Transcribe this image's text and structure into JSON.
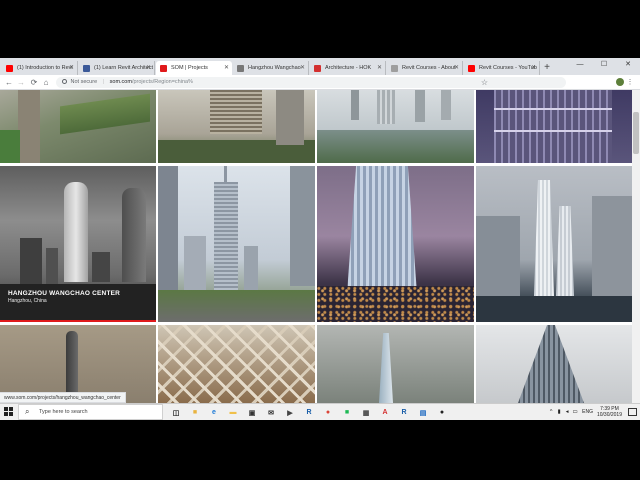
{
  "browser": {
    "tabs": [
      {
        "label": "(1) Introduction to Revi",
        "favicon": "youtube-icon",
        "color": "#ff0000",
        "active": false
      },
      {
        "label": "(1) Learn Revit Architect",
        "favicon": "facebook-icon",
        "color": "#3b5998",
        "active": false
      },
      {
        "label": "SOM | Projects",
        "favicon": "som-icon",
        "color": "#e0191b",
        "active": true
      },
      {
        "label": "Hangzhou Wangchao",
        "favicon": "page-icon",
        "color": "#777777",
        "active": false
      },
      {
        "label": "Architecture - HOK",
        "favicon": "hok-icon",
        "color": "#d32f2f",
        "active": false
      },
      {
        "label": "Revit Courses - About",
        "favicon": "page-icon",
        "color": "#9e9e9e",
        "active": false
      },
      {
        "label": "Revit Courses - YouTub",
        "favicon": "youtube-icon",
        "color": "#ff0000",
        "active": false
      }
    ],
    "new_tab": "+",
    "window_controls": [
      "—",
      "☐",
      "✕"
    ],
    "nav": {
      "back": "←",
      "forward": "→",
      "reload": "⟳",
      "home": "⌂"
    },
    "address": {
      "security": "Not secure",
      "separator": "|",
      "host": "som.com",
      "path": "/projects/Region=china%"
    },
    "bookmark_star": "☆",
    "menu": "⋮"
  },
  "page": {
    "featured": {
      "title": "HANGZHOU WANGCHAO CENTER",
      "subtitle": "Hangzhou, China"
    },
    "status_url": "www.som.com/projects/hangzhou_wangchao_center"
  },
  "taskbar": {
    "search_placeholder": "Type here to search",
    "apps": [
      {
        "name": "task-view-icon",
        "glyph": "◫",
        "color": "#222222"
      },
      {
        "name": "file-explorer-icon",
        "glyph": "■",
        "color": "#e8b33f"
      },
      {
        "name": "edge-icon",
        "glyph": "e",
        "color": "#1e7ad6"
      },
      {
        "name": "folder-icon",
        "glyph": "▬",
        "color": "#f0c04a"
      },
      {
        "name": "store-icon",
        "glyph": "▣",
        "color": "#333333"
      },
      {
        "name": "mail-icon",
        "glyph": "✉",
        "color": "#333333"
      },
      {
        "name": "media-icon",
        "glyph": "▶",
        "color": "#444444"
      },
      {
        "name": "revit-icon",
        "glyph": "R",
        "color": "#1a5ea8"
      },
      {
        "name": "chrome-icon",
        "glyph": "●",
        "color": "#db4437"
      },
      {
        "name": "app-green-icon",
        "glyph": "■",
        "color": "#1db954"
      },
      {
        "name": "calculator-icon",
        "glyph": "▦",
        "color": "#444444"
      },
      {
        "name": "acrobat-icon",
        "glyph": "A",
        "color": "#d32f2f"
      },
      {
        "name": "revit2-icon",
        "glyph": "R",
        "color": "#1a5ea8"
      },
      {
        "name": "photos-icon",
        "glyph": "▤",
        "color": "#1565c0"
      },
      {
        "name": "app-dark-icon",
        "glyph": "●",
        "color": "#222222"
      }
    ],
    "tray": {
      "language": "ENG",
      "time": "7:39 PM",
      "date": "10/30/2019"
    }
  },
  "colors": {
    "accent": "#e0191b",
    "caption_bg": "#2a2a2a"
  }
}
